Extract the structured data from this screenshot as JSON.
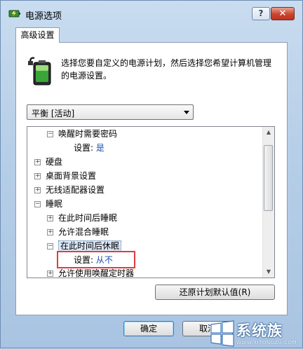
{
  "window": {
    "title": "电源选项",
    "help_label": "?",
    "close_label": "✕"
  },
  "tab": {
    "label": "高级设置"
  },
  "description": "选择您要自定义的电源计划，然后选择您希望计算机管理的电源设置。",
  "plan_select": {
    "value": "平衡 [活动]"
  },
  "tree": {
    "rows": [
      {
        "label": "唤醒时需要密码",
        "toggle": "⊟"
      },
      {
        "label": "设置:",
        "value": "是"
      },
      {
        "label": "硬盘",
        "toggle": "+"
      },
      {
        "label": "桌面背景设置",
        "toggle": "+"
      },
      {
        "label": "无线适配器设置",
        "toggle": "+"
      },
      {
        "label": "睡眠",
        "toggle": "−"
      },
      {
        "label": "在此时间后睡眠",
        "toggle": "+"
      },
      {
        "label": "允许混合睡眠",
        "toggle": "+"
      },
      {
        "label": "在此时间后休眠",
        "toggle": "−"
      },
      {
        "label": "设置:",
        "value": "从不"
      },
      {
        "label": "允许使用唤醒定时器",
        "toggle": "+"
      }
    ]
  },
  "buttons": {
    "restore": "还原计划默认值(R)",
    "ok": "确定",
    "cancel": "取消"
  },
  "watermark": {
    "brand": "系统族",
    "url": "WWW.XITONGZU.COM"
  },
  "colors": {
    "link": "#1a4fae",
    "highlight": "#dbe8f7",
    "annotation": "#e03d3d"
  }
}
